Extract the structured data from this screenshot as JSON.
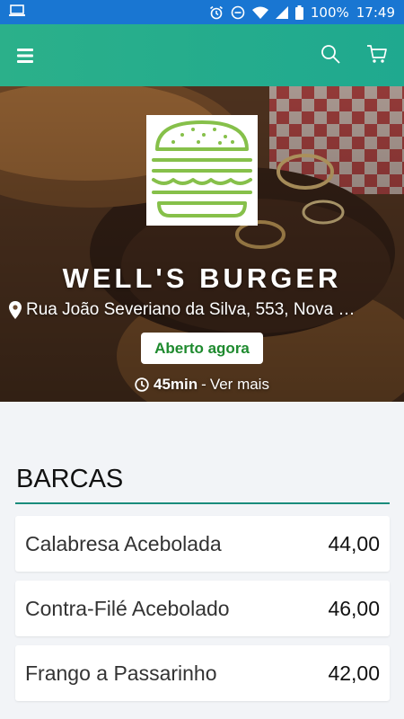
{
  "status_bar": {
    "battery": "100%",
    "time": "17:49"
  },
  "app_bar": {
    "icons": [
      "menu-icon",
      "search-icon",
      "cart-icon"
    ],
    "color": "#22ad8c"
  },
  "restaurant": {
    "name": "WELL'S BURGER",
    "address": "Rua João Severiano da Silva, 553, Nova …",
    "status": "Aberto agora",
    "delivery_time": "45min",
    "separator": "-",
    "more_link": "Ver mais"
  },
  "menu": {
    "section_title": "BARCAS",
    "items": [
      {
        "name": "Calabresa Acebolada",
        "price": "44,00"
      },
      {
        "name": "Contra-Filé Acebolado",
        "price": "46,00"
      },
      {
        "name": "Frango a Passarinho",
        "price": "42,00"
      }
    ]
  },
  "colors": {
    "status_bar": "#1976d2",
    "accent": "#1a8c7c",
    "open_green": "#1e8a2e"
  }
}
